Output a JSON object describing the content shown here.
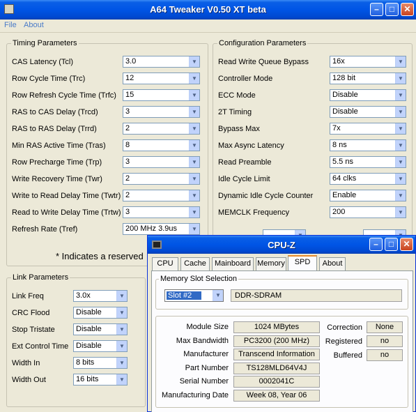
{
  "tweaker": {
    "title": "A64 Tweaker V0.50 XT beta",
    "menu": [
      "File",
      "About"
    ],
    "timing": {
      "legend": "Timing Parameters",
      "rows": [
        {
          "label": "CAS Latency (Tcl)",
          "value": "3.0"
        },
        {
          "label": "Row Cycle Time (Trc)",
          "value": "12"
        },
        {
          "label": "Row Refresh Cycle Time (Trfc)",
          "value": "15"
        },
        {
          "label": "RAS to CAS Delay (Trcd)",
          "value": "3"
        },
        {
          "label": "RAS to RAS Delay (Trrd)",
          "value": "2"
        },
        {
          "label": "Min RAS Active Time (Tras)",
          "value": "8"
        },
        {
          "label": "Row Precharge Time (Trp)",
          "value": "3"
        },
        {
          "label": "Write Recovery Time (Twr)",
          "value": "2"
        },
        {
          "label": "Write to Read Delay Time (Twtr)",
          "value": "2"
        },
        {
          "label": "Read to Write Delay Time (Trtw)",
          "value": "3"
        },
        {
          "label": "Refresh Rate (Tref)",
          "value": "200 MHz 3.9us"
        }
      ]
    },
    "config": {
      "legend": "Configuration Parameters",
      "rows": [
        {
          "label": "Read Write Queue Bypass",
          "value": "16x"
        },
        {
          "label": "Controller Mode",
          "value": "128 bit"
        },
        {
          "label": "ECC Mode",
          "value": "Disable"
        },
        {
          "label": "2T Timing",
          "value": "Disable"
        },
        {
          "label": "Bypass Max",
          "value": "7x"
        },
        {
          "label": "Max Async Latency",
          "value": "8 ns"
        },
        {
          "label": "Read Preamble",
          "value": "5.5 ns"
        },
        {
          "label": "Idle Cycle Limit",
          "value": "64 clks"
        },
        {
          "label": "Dynamic Idle Cycle Counter",
          "value": "Enable"
        },
        {
          "label": "MEMCLK Frequency",
          "value": "200"
        }
      ]
    },
    "note": "* Indicates a reserved",
    "link": {
      "legend": "Link Parameters",
      "rows": [
        {
          "label": "Link Freq",
          "value": "3.0x"
        },
        {
          "label": "CRC Flood",
          "value": "Disable"
        },
        {
          "label": "Stop Tristate",
          "value": "Disable"
        },
        {
          "label": "Ext Control Time",
          "value": "Disable"
        },
        {
          "label": "Width In",
          "value": "8 bits"
        },
        {
          "label": "Width Out",
          "value": "16 bits"
        }
      ]
    }
  },
  "cpuz": {
    "title": "CPU-Z",
    "tabs": [
      "CPU",
      "Cache",
      "Mainboard",
      "Memory",
      "SPD",
      "About"
    ],
    "active_tab": "SPD",
    "slot_group": "Memory Slot Selection",
    "slot": "Slot #2",
    "mem_type": "DDR-SDRAM",
    "fields": [
      {
        "label": "Module Size",
        "value": "1024 MBytes"
      },
      {
        "label": "Max Bandwidth",
        "value": "PC3200 (200 MHz)"
      },
      {
        "label": "Manufacturer",
        "value": "Transcend Information"
      },
      {
        "label": "Part Number",
        "value": "TS128MLD64V4J"
      },
      {
        "label": "Serial Number",
        "value": "0002041C"
      },
      {
        "label": "Manufacturing Date",
        "value": "Week 08, Year 06"
      }
    ],
    "side_fields": [
      {
        "label": "Correction",
        "value": "None"
      },
      {
        "label": "Registered",
        "value": "no"
      },
      {
        "label": "Buffered",
        "value": "no"
      }
    ]
  }
}
